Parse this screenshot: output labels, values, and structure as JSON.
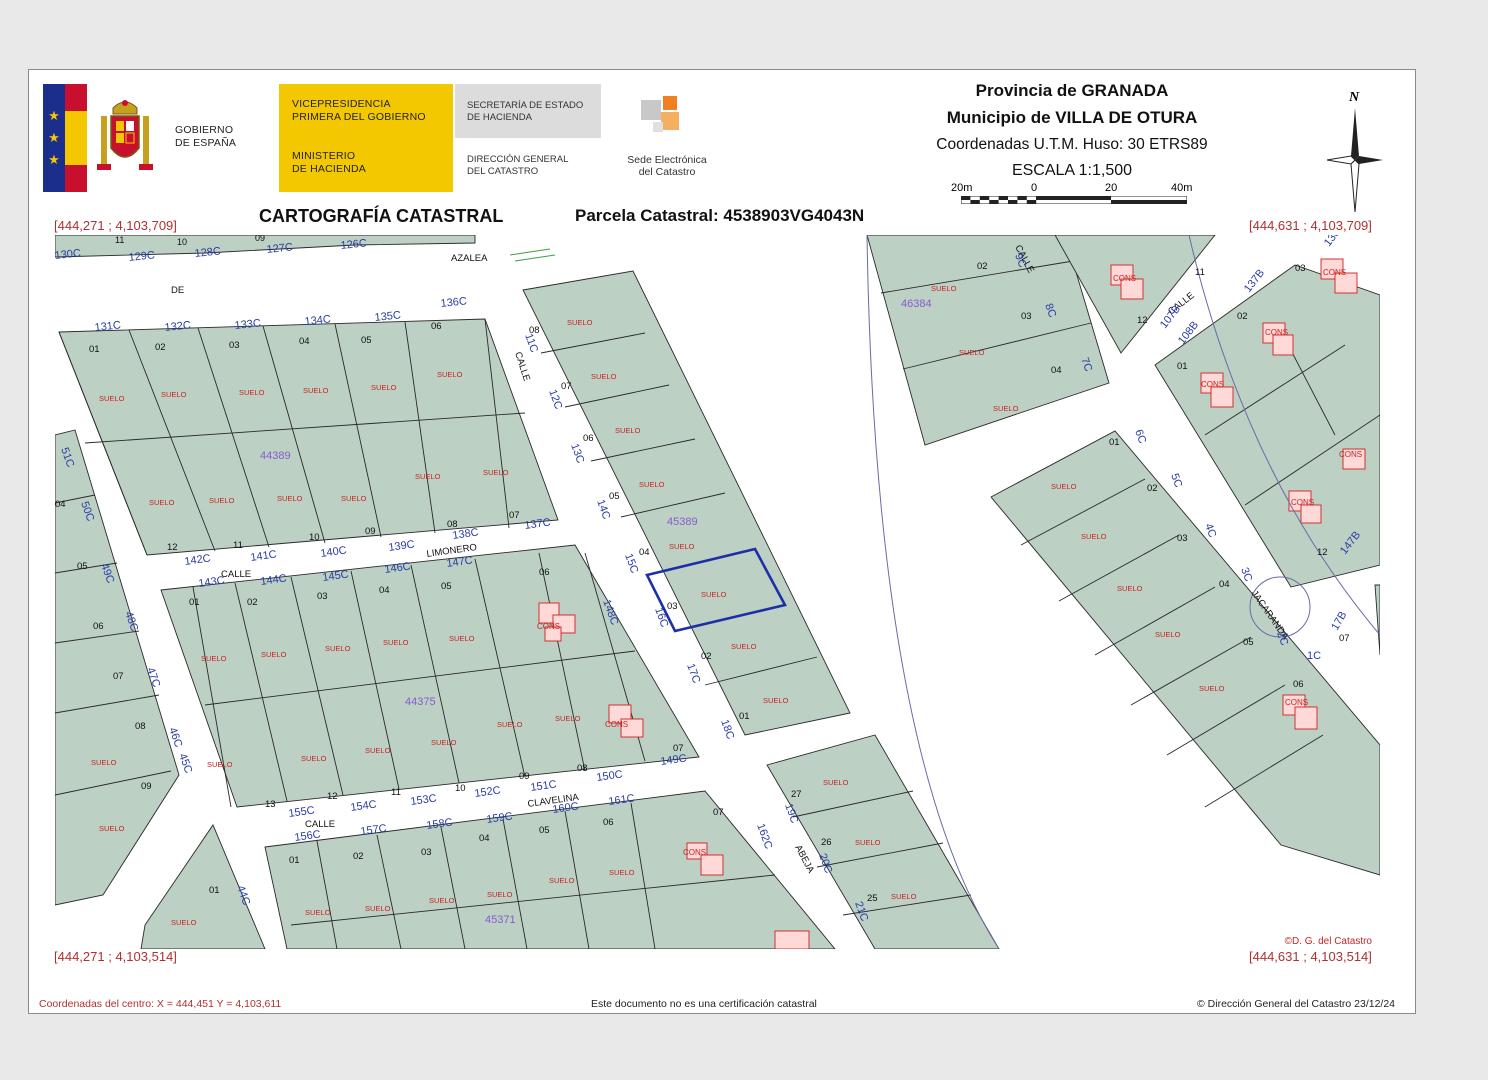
{
  "header": {
    "gobierno": [
      "GOBIERNO",
      "DE ESPAÑA"
    ],
    "vicepresidencia": [
      "VICEPRESIDENCIA",
      "PRIMERA DEL GOBIERNO"
    ],
    "ministerio": [
      "MINISTERIO",
      "DE HACIENDA"
    ],
    "secretaria": [
      "SECRETARÍA DE ESTADO",
      "DE HACIENDA"
    ],
    "direccion": [
      "DIRECCIÓN GENERAL",
      "DEL CATASTRO"
    ],
    "sede": [
      "Sede Electrónica",
      "del Catastro"
    ],
    "provincia": "Provincia de GRANADA",
    "municipio": "Municipio de VILLA DE OTURA",
    "coordenadas": "Coordenadas U.T.M. Huso: 30 ETRS89",
    "escala": "ESCALA 1:1,500",
    "scale_labels": [
      "20m",
      "0",
      "20",
      "40m"
    ],
    "north": "N",
    "cartografia": "CARTOGRAFÍA CATASTRAL",
    "parcela": "Parcela Catastral: 4538903VG4043N"
  },
  "corners": {
    "top_left": "[444,271 ; 4,103,709]",
    "top_right": "[444,631 ; 4,103,709]",
    "bottom_left": "[444,271 ; 4,103,514]",
    "bottom_right": "[444,631 ; 4,103,514]"
  },
  "map": {
    "credit": "©D. G. del Catastro",
    "block_ids": [
      "44389",
      "45389",
      "44375",
      "45371",
      "46384"
    ],
    "street_words": [
      "AZALEA",
      "DE",
      "CALLE",
      "LIMONERO",
      "CALLE",
      "CLAVELINA",
      "CALLE",
      "ABEJA",
      "CALLE",
      "CALLE",
      "JACARANDA",
      "CALLE"
    ],
    "suelo_label": "SUELO",
    "cons_label": "CONS",
    "top_row_numbers": [
      "131C",
      "132C",
      "133C",
      "134C",
      "135C",
      "136C"
    ],
    "north_row_numbers": [
      "130C",
      "129C",
      "128C",
      "127C",
      "126C"
    ],
    "north_row_parcels": [
      "11",
      "10",
      "09"
    ],
    "block1_parcels": [
      "01",
      "02",
      "03",
      "04",
      "05",
      "06",
      "07",
      "08",
      "09",
      "10",
      "11",
      "12"
    ],
    "limonero_numbers": [
      "142C",
      "141C",
      "140C",
      "139C",
      "138C",
      "137C",
      "143C",
      "144C",
      "145C",
      "146C",
      "147C"
    ],
    "calle_numbers": [
      "11C",
      "12C",
      "13C",
      "14C",
      "15C",
      "16C",
      "17C",
      "18C",
      "148C"
    ],
    "east_parcels": [
      "08",
      "07",
      "06",
      "05",
      "04",
      "03",
      "02",
      "01"
    ],
    "block3_parcels_top": [
      "01",
      "02",
      "03",
      "04",
      "05",
      "06"
    ],
    "block3_parcels_bot": [
      "13",
      "12",
      "11",
      "10",
      "09",
      "08",
      "07"
    ],
    "clavelina_numbers": [
      "155C",
      "154C",
      "153C",
      "152C",
      "151C",
      "150C",
      "149C",
      "156C",
      "157C",
      "158C",
      "159C",
      "160C",
      "161C"
    ],
    "block4_parcels": [
      "01",
      "02",
      "03",
      "04",
      "05",
      "06",
      "07"
    ],
    "abeja_numbers": [
      "19C",
      "20C",
      "21C",
      "162C"
    ],
    "abeja_parcels": [
      "27",
      "26",
      "25"
    ],
    "west_numbers": [
      "51C",
      "50C",
      "49C",
      "48C",
      "47C",
      "46C",
      "45C",
      "44C"
    ],
    "west_parcels": [
      "04",
      "05",
      "06",
      "07",
      "08",
      "09",
      "01"
    ],
    "right_block_parcels": [
      "02",
      "03",
      "04",
      "01",
      "02",
      "03",
      "04",
      "05",
      "06"
    ],
    "right_numbers": [
      "9C",
      "8C",
      "7C",
      "6C",
      "5C",
      "4C",
      "3C",
      "2C",
      "1C"
    ],
    "far_right_numbers": [
      "107B",
      "108B",
      "137B",
      "136B",
      "147B",
      "17B"
    ],
    "far_right_parcels": [
      "11",
      "12",
      "02",
      "03",
      "01",
      "12",
      "07"
    ]
  },
  "footer": {
    "centro": "Coordenadas del centro: X = 444,451 Y = 4,103,611",
    "aviso": "Este documento no es una certificación catastral",
    "copyright": "© Dirección General del Catastro 23/12/24"
  },
  "colors": {
    "parcel_fill": "#bcd0c4",
    "parcel_stroke": "#2a2a2a",
    "block_stroke": "#6a6aa8",
    "street_text": "#2a3da8",
    "suelo_text": "#cc2222",
    "selected": "#1d2fa8",
    "flag_red": "#c8102e",
    "flag_blue": "#1c2e8c",
    "gov_yellow": "#f4c800"
  }
}
